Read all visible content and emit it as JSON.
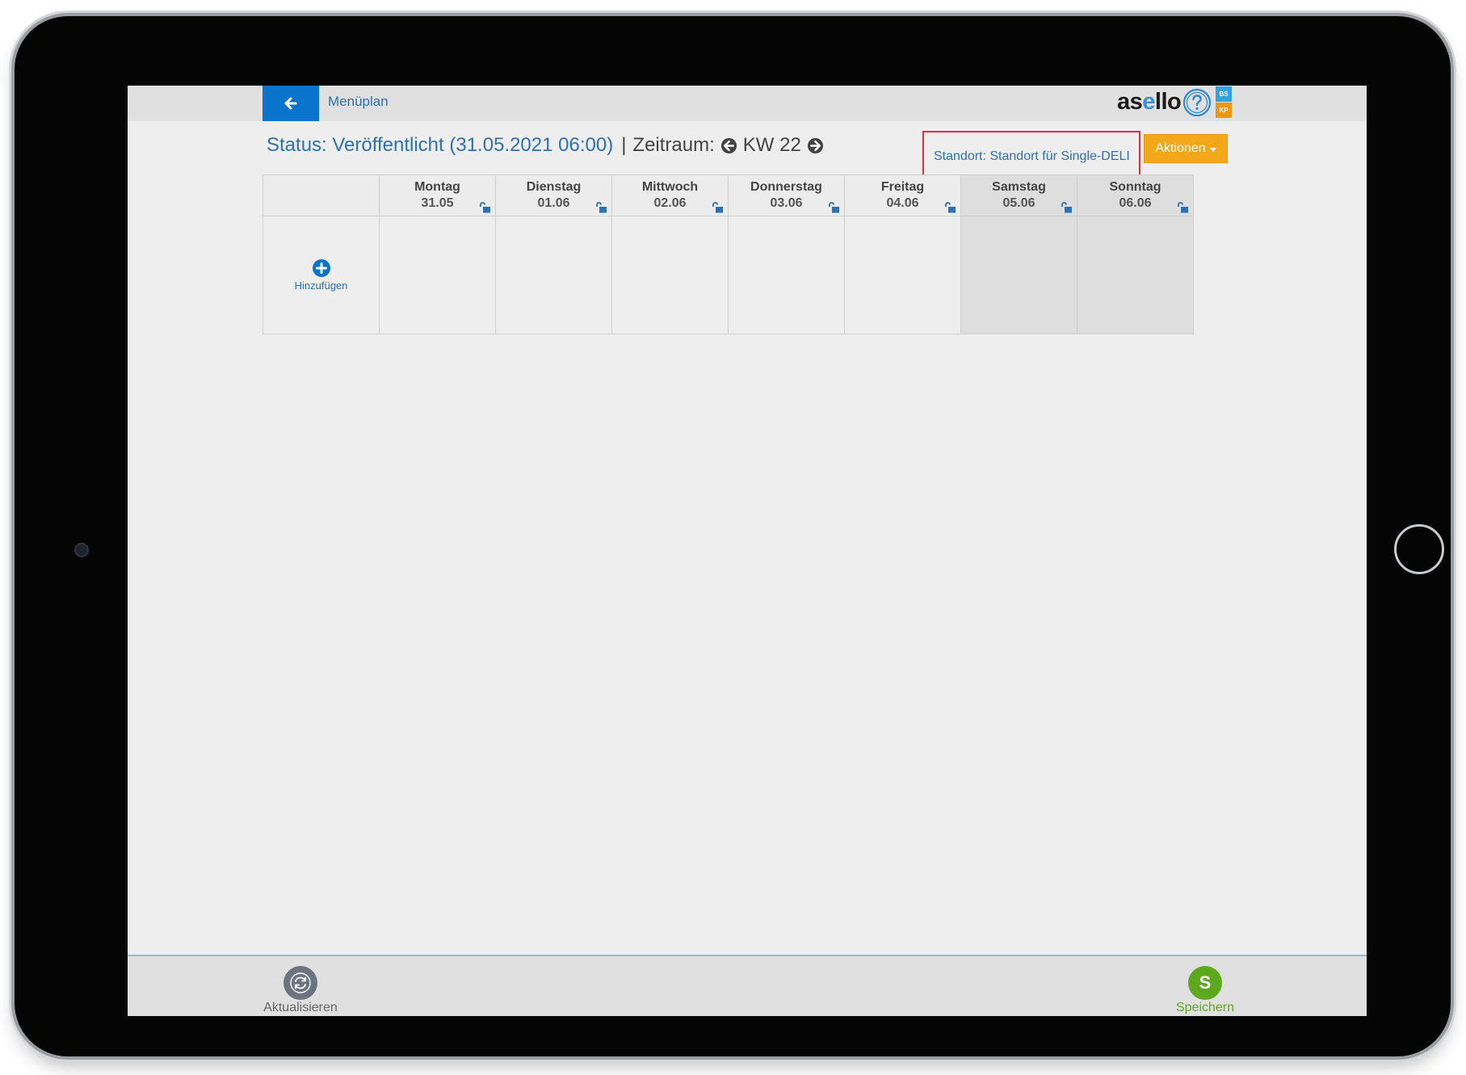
{
  "header": {
    "page_name": "Menüplan",
    "logo": {
      "prefix": "as",
      "highlight": "e",
      "suffix": "llo"
    },
    "badges": {
      "bs": "BS",
      "kp": "KP"
    }
  },
  "status": {
    "label": "Status: Veröffentlicht (31.05.2021 06:00)",
    "separator": "|",
    "period_label": "Zeitraum:",
    "week": "KW 22"
  },
  "standort": {
    "label": "Standort: Standort für Single-DELI"
  },
  "aktionen": {
    "label": "Aktionen"
  },
  "plan": {
    "add_label": "Hinzufügen",
    "days": [
      {
        "name": "Montag",
        "date": "31.05"
      },
      {
        "name": "Dienstag",
        "date": "01.06"
      },
      {
        "name": "Mittwoch",
        "date": "02.06"
      },
      {
        "name": "Donnerstag",
        "date": "03.06"
      },
      {
        "name": "Freitag",
        "date": "04.06"
      },
      {
        "name": "Samstag",
        "date": "05.06"
      },
      {
        "name": "Sonntag",
        "date": "06.06"
      }
    ]
  },
  "footer": {
    "refresh_label": "Aktualisieren",
    "save_label": "Speichern",
    "save_initial": "S"
  },
  "colors": {
    "primary_blue": "#0a74cc",
    "link_blue": "#2f6fb4",
    "aktionen_orange": "#f3a81c",
    "save_green": "#5da91e",
    "highlight_red": "#e03030"
  },
  "icons": [
    "arrow-left-icon",
    "help-icon",
    "arrow-circle-left-icon",
    "arrow-circle-right-icon",
    "unlock-icon",
    "plus-circle-icon",
    "refresh-icon"
  ]
}
